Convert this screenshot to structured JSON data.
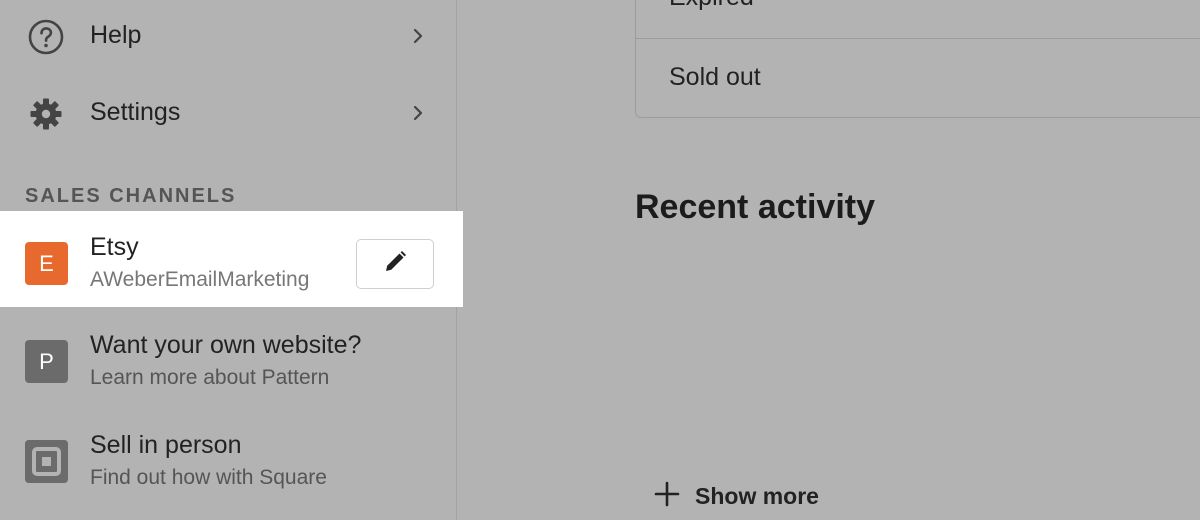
{
  "sidebar": {
    "nav": [
      {
        "label": "Help",
        "icon": "help-circle-icon"
      },
      {
        "label": "Settings",
        "icon": "gear-icon"
      }
    ],
    "section_title": "SALES CHANNELS",
    "channels": [
      {
        "badge": "E",
        "title": "Etsy",
        "subtitle": "AWeberEmailMarketing",
        "badge_color": "#e8692d"
      },
      {
        "badge": "P",
        "title": "Want your own website?",
        "subtitle": "Learn more about Pattern",
        "badge_color": "#6b6b6b"
      },
      {
        "badge": "",
        "title": "Sell in person",
        "subtitle": "Find out how with Square",
        "badge_color": "#6b6b6b",
        "icon": "square-logo-icon"
      }
    ]
  },
  "main": {
    "filters": [
      "Expired",
      "Sold out"
    ],
    "recent_title": "Recent activity",
    "show_more": "Show more"
  }
}
